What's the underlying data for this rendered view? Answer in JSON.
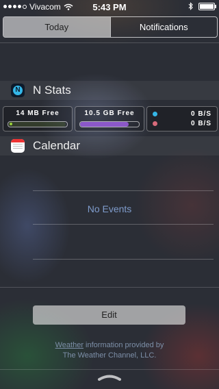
{
  "status_bar": {
    "carrier": "Vivacom",
    "time": "5:43 PM"
  },
  "segments": {
    "today": "Today",
    "notifications": "Notifications"
  },
  "nstats": {
    "title": "N Stats",
    "memory_label": "14 MB Free",
    "memory_fraction": 0.98,
    "storage_label": "10.5 GB Free",
    "storage_fraction": 0.82,
    "download": "0 B/S",
    "upload": "0 B/S",
    "colors": {
      "memory": "#9bd33a",
      "storage": "#8b58c9",
      "download": "#35b6e6",
      "upload": "#d76a7a"
    }
  },
  "calendar": {
    "title": "Calendar",
    "empty_text": "No Events"
  },
  "edit_label": "Edit",
  "credit": {
    "link": "Weather",
    "line1_rest": " information provided by",
    "line2": "The Weather Channel, LLC."
  }
}
